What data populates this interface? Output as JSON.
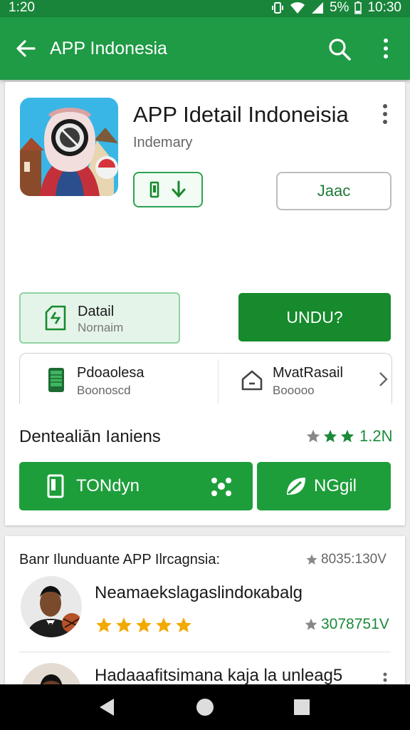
{
  "status_bar": {
    "time_left": "1:20",
    "battery": "5%",
    "time_right": "10:30"
  },
  "app_bar": {
    "title": "APP Indonesia"
  },
  "app_card": {
    "title": "APP Idetail Indoneisia",
    "subtitle": "Indemary",
    "secondary_button": "Jaac",
    "detail_button": {
      "title": "Datail",
      "subtitle": "Nornaim"
    },
    "download_button": "UNDU?",
    "info": [
      {
        "title": "Pdoaolesa",
        "subtitle": "Boonoscd"
      },
      {
        "title": "MvatRasail",
        "subtitle": "Booooo"
      }
    ],
    "rating_label": "Dentealiān Ianiens",
    "rating_value": "1.2N",
    "actions": [
      {
        "label": "TONdyn"
      },
      {
        "label": "NGgil"
      }
    ]
  },
  "reviews": {
    "header": "Banr Ilunduante APP Ilrcagnsia:",
    "header_value": "8035:130V",
    "items": [
      {
        "name": "Neamaekslagaslindoкabalg",
        "stars": 5,
        "value": "3078751V"
      },
      {
        "name": "Hadaaafitsimana kaja la unleag5"
      }
    ]
  },
  "colors": {
    "primary": "#1f9a45",
    "dark_green": "#168a2c",
    "star_gold": "#f2a900",
    "star_green": "#1b8a3a"
  }
}
